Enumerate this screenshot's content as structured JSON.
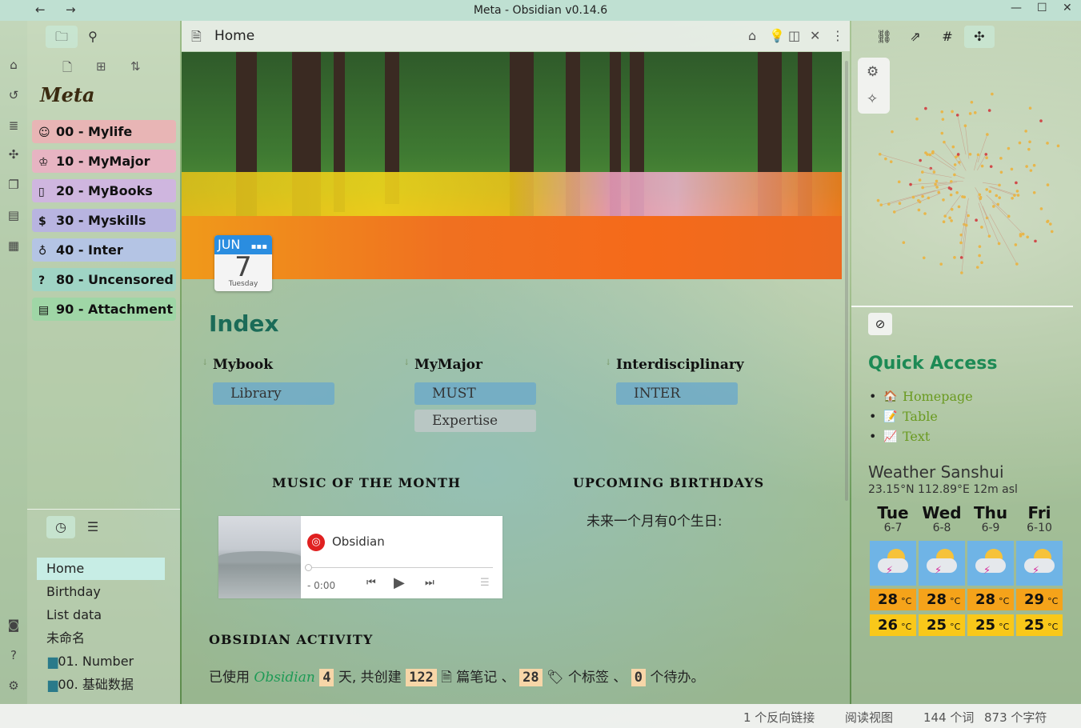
{
  "window": {
    "title": "Meta - Obsidian v0.14.6",
    "back": "←",
    "forward": "→",
    "minimize": "—",
    "maximize": "☐",
    "close": "✕"
  },
  "ribbon": [
    "home-icon",
    "history-icon",
    "notes-icon",
    "graph-icon",
    "copy-icon",
    "cards-icon",
    "table-icon",
    "vault-icon",
    "help-icon",
    "settings-icon"
  ],
  "left_panel": {
    "vault_name": "Meta",
    "folders": [
      {
        "label": "00 - Mylife",
        "icon": "☺",
        "color": "#e8b5b5"
      },
      {
        "label": "10 - MyMajor",
        "icon": "♔",
        "color": "#e7b4c2"
      },
      {
        "label": "20 - MyBooks",
        "icon": "▯",
        "color": "#cfb6df"
      },
      {
        "label": "30 - Myskills",
        "icon": "$",
        "color": "#b8b4e0"
      },
      {
        "label": "40 - Inter",
        "icon": "♁",
        "color": "#b4c4e4"
      },
      {
        "label": "80 - Uncensored",
        "icon": "?",
        "color": "#9fd4c4"
      },
      {
        "label": "90 - Attachment",
        "icon": "▤",
        "color": "#9fd6a6"
      }
    ]
  },
  "recent": [
    "Home",
    "Birthday",
    "List data",
    "未命名",
    "01. Number",
    "00. 基础数据"
  ],
  "main": {
    "tab_title": "Home",
    "calendar": {
      "month": "JUN",
      "day": "7",
      "weekday": "Tuesday"
    },
    "index_title": "Index",
    "columns": [
      {
        "head": "Mybook",
        "pills": [
          {
            "label": "Library",
            "style": "blue"
          }
        ]
      },
      {
        "head": "MyMajor",
        "pills": [
          {
            "label": "MUST",
            "style": "blue"
          },
          {
            "label": "Expertise",
            "style": "grey"
          }
        ]
      },
      {
        "head": "Interdisciplinary",
        "pills": [
          {
            "label": "INTER",
            "style": "blue"
          }
        ]
      }
    ],
    "music_title": "MUSIC OF THE MONTH",
    "birthday_title": "UPCOMING BIRTHDAYS",
    "birthday_text": "未来一个月有0个生日:",
    "player": {
      "name": "Obsidian",
      "time": "- 0:00"
    },
    "activity_title": "OBSIDIAN ACTIVITY",
    "activity": {
      "p1": "已使用 ",
      "obsidian": "Obsidian",
      "days": "4",
      "p2": " 天, 共创建 ",
      "notes": "122",
      "p3": " 篇笔记 、 ",
      "tags": "28",
      "p4": " 个标签 、 ",
      "todos": "0",
      "p5": " 个待办。"
    }
  },
  "right_panel": {
    "quick_access_title": "Quick Access",
    "quick_links": [
      {
        "label": "Homepage",
        "icon": "🏠"
      },
      {
        "label": "Table",
        "icon": "📝"
      },
      {
        "label": "Text",
        "icon": "📈"
      }
    ],
    "weather": {
      "title": "Weather Sanshui",
      "location": "23.15°N 112.89°E 12m asl",
      "unit": "°C",
      "days": [
        {
          "name": "Tue",
          "date": "6-7",
          "hi": "28",
          "lo": "26"
        },
        {
          "name": "Wed",
          "date": "6-8",
          "hi": "28",
          "lo": "25"
        },
        {
          "name": "Thu",
          "date": "6-9",
          "hi": "28",
          "lo": "25"
        },
        {
          "name": "Fri",
          "date": "6-10",
          "hi": "29",
          "lo": "25"
        }
      ]
    }
  },
  "status": {
    "backlinks": "1 个反向链接",
    "mode": "阅读视图",
    "words": "144 个词",
    "chars": "873 个字符"
  }
}
